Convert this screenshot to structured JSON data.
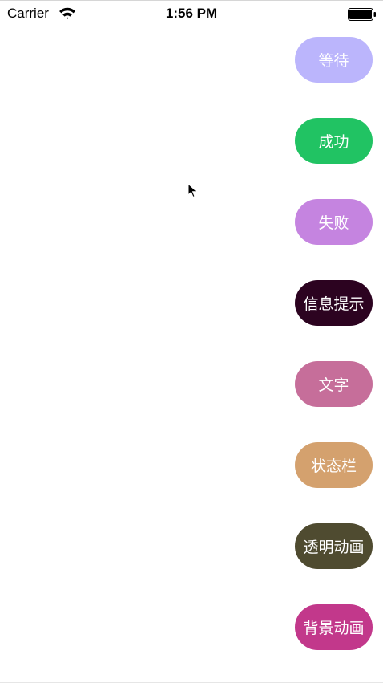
{
  "status_bar": {
    "carrier": "Carrier",
    "time": "1:56 PM"
  },
  "buttons": [
    {
      "label": "等待",
      "color": "#bbb5fc"
    },
    {
      "label": "成功",
      "color": "#21c363"
    },
    {
      "label": "失败",
      "color": "#c584e0"
    },
    {
      "label": "信息提示",
      "color": "#2c0320"
    },
    {
      "label": "文字",
      "color": "#c66e9a"
    },
    {
      "label": "状态栏",
      "color": "#d4a16e"
    },
    {
      "label": "透明动画",
      "color": "#4f4b30"
    },
    {
      "label": "背景动画",
      "color": "#c2388b"
    }
  ]
}
